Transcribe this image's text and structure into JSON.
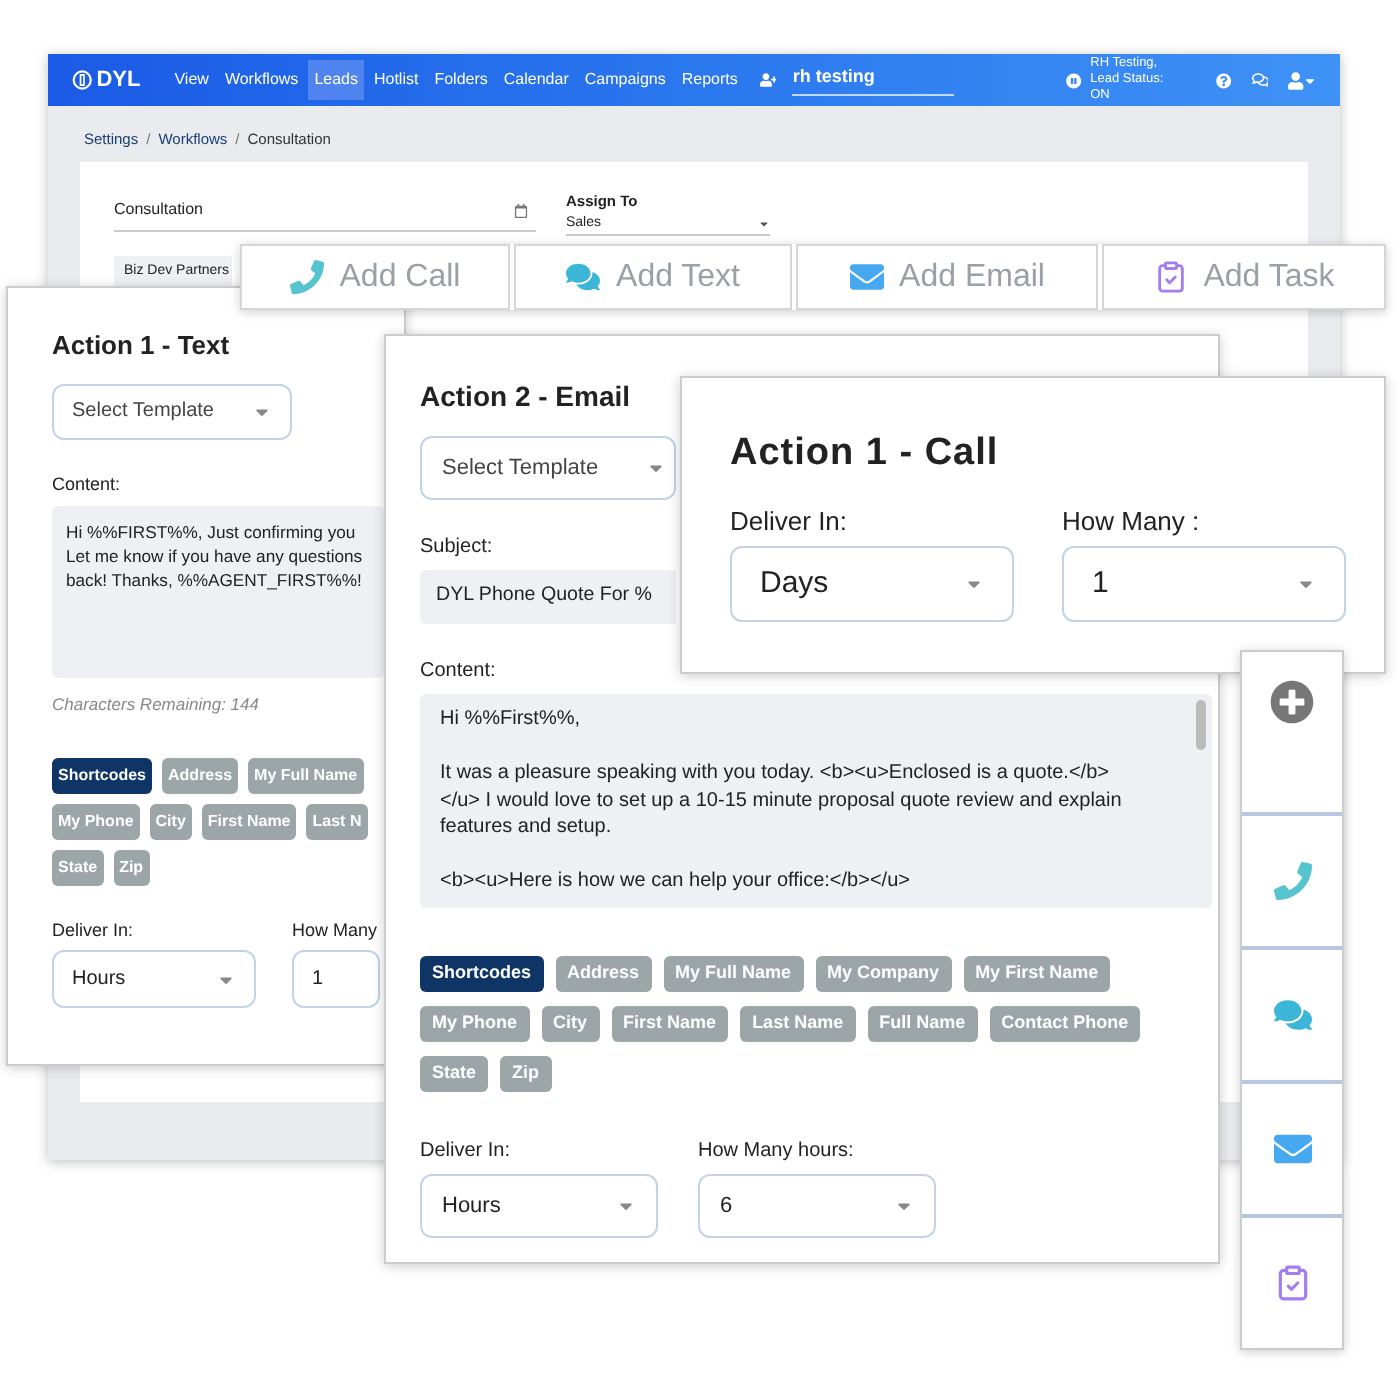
{
  "app": {
    "logo": "DYL",
    "nav": [
      {
        "label": "View",
        "selected": false
      },
      {
        "label": "Workflows",
        "selected": false
      },
      {
        "label": "Leads",
        "selected": true
      },
      {
        "label": "Hotlist",
        "selected": false
      },
      {
        "label": "Folders",
        "selected": false
      },
      {
        "label": "Calendar",
        "selected": false
      },
      {
        "label": "Campaigns",
        "selected": false
      },
      {
        "label": "Reports",
        "selected": false
      }
    ],
    "search": {
      "value": "rh testing"
    },
    "status_lines": [
      "RH Testing,",
      "Lead Status: ON"
    ],
    "breadcrumb": [
      {
        "kind": "link",
        "text": "Settings"
      },
      {
        "kind": "separator",
        "text": "/"
      },
      {
        "kind": "link",
        "text": "Workflows"
      },
      {
        "kind": "separator",
        "text": "/"
      },
      {
        "kind": "current",
        "text": "Consultation"
      }
    ],
    "form": {
      "name": "Consultation",
      "assign_label": "Assign To",
      "assign_value": "Sales",
      "tag": "Biz Dev Partners"
    }
  },
  "action_bar": [
    {
      "kind": "call",
      "label": "Add Call"
    },
    {
      "kind": "text",
      "label": "Add Text"
    },
    {
      "kind": "email",
      "label": "Add Email"
    },
    {
      "kind": "task",
      "label": "Add Task"
    }
  ],
  "text_action": {
    "title": "Action 1 - Text",
    "template": "Select Template",
    "content_label": "Content:",
    "content_lines": [
      "Hi %%FIRST%%, Just confirming you",
      "Let me know if you have any questions",
      "back! Thanks, %%AGENT_FIRST%%!"
    ],
    "remaining": "Characters Remaining: 144",
    "shortcode_rows": [
      [
        {
          "label": "Shortcodes",
          "selected": true
        },
        {
          "label": "Address",
          "selected": false
        },
        {
          "label": "My Full Name",
          "selected": false
        }
      ],
      [
        {
          "label": "My Phone",
          "selected": false
        },
        {
          "label": "City",
          "selected": false
        },
        {
          "label": "First Name",
          "selected": false
        },
        {
          "label": "Last N",
          "selected": false
        }
      ],
      [
        {
          "label": "State",
          "selected": false
        },
        {
          "label": "Zip",
          "selected": false
        }
      ]
    ],
    "deliver_label": "Deliver In:",
    "deliver_value": "Hours",
    "how_many_label": "How Many",
    "how_many_value": "1"
  },
  "email_action": {
    "title": "Action 2 - Email",
    "template": "Select Template",
    "subject_label": "Subject:",
    "subject_value": "DYL Phone Quote For %",
    "content_label": "Content:",
    "content_paragraphs": [
      [
        "Hi %%First%%,"
      ],
      [
        "It was a pleasure speaking with you today. <b><u>Enclosed is a quote.</b>",
        "</u> I would love to set up a 10-15 minute proposal quote review and explain",
        "features and setup."
      ],
      [
        "<b><u>Here is how we can help your office:</b></u>"
      ]
    ],
    "shortcode_rows": [
      [
        {
          "label": "Shortcodes",
          "selected": true
        },
        {
          "label": "Address",
          "selected": false
        },
        {
          "label": "My Full Name",
          "selected": false
        },
        {
          "label": "My Company",
          "selected": false
        },
        {
          "label": "My First Name",
          "selected": false
        }
      ],
      [
        {
          "label": "My Phone",
          "selected": false
        },
        {
          "label": "City",
          "selected": false
        },
        {
          "label": "First Name",
          "selected": false
        },
        {
          "label": "Last Name",
          "selected": false
        },
        {
          "label": "Full Name",
          "selected": false
        },
        {
          "label": "Contact Phone",
          "selected": false
        }
      ],
      [
        {
          "label": "State",
          "selected": false
        },
        {
          "label": "Zip",
          "selected": false
        }
      ]
    ],
    "deliver_label": "Deliver In:",
    "deliver_value": "Hours",
    "how_many_label": "How Many hours:",
    "how_many_value": "6"
  },
  "call_action": {
    "title": "Action 1 - Call",
    "deliver_label": "Deliver In:",
    "deliver_value": "Days",
    "how_many_label": "How Many :",
    "how_many_value": "1"
  },
  "side_buttons": [
    {
      "kind": "add"
    },
    {
      "kind": "call"
    },
    {
      "kind": "text"
    },
    {
      "kind": "email"
    },
    {
      "kind": "task"
    }
  ]
}
